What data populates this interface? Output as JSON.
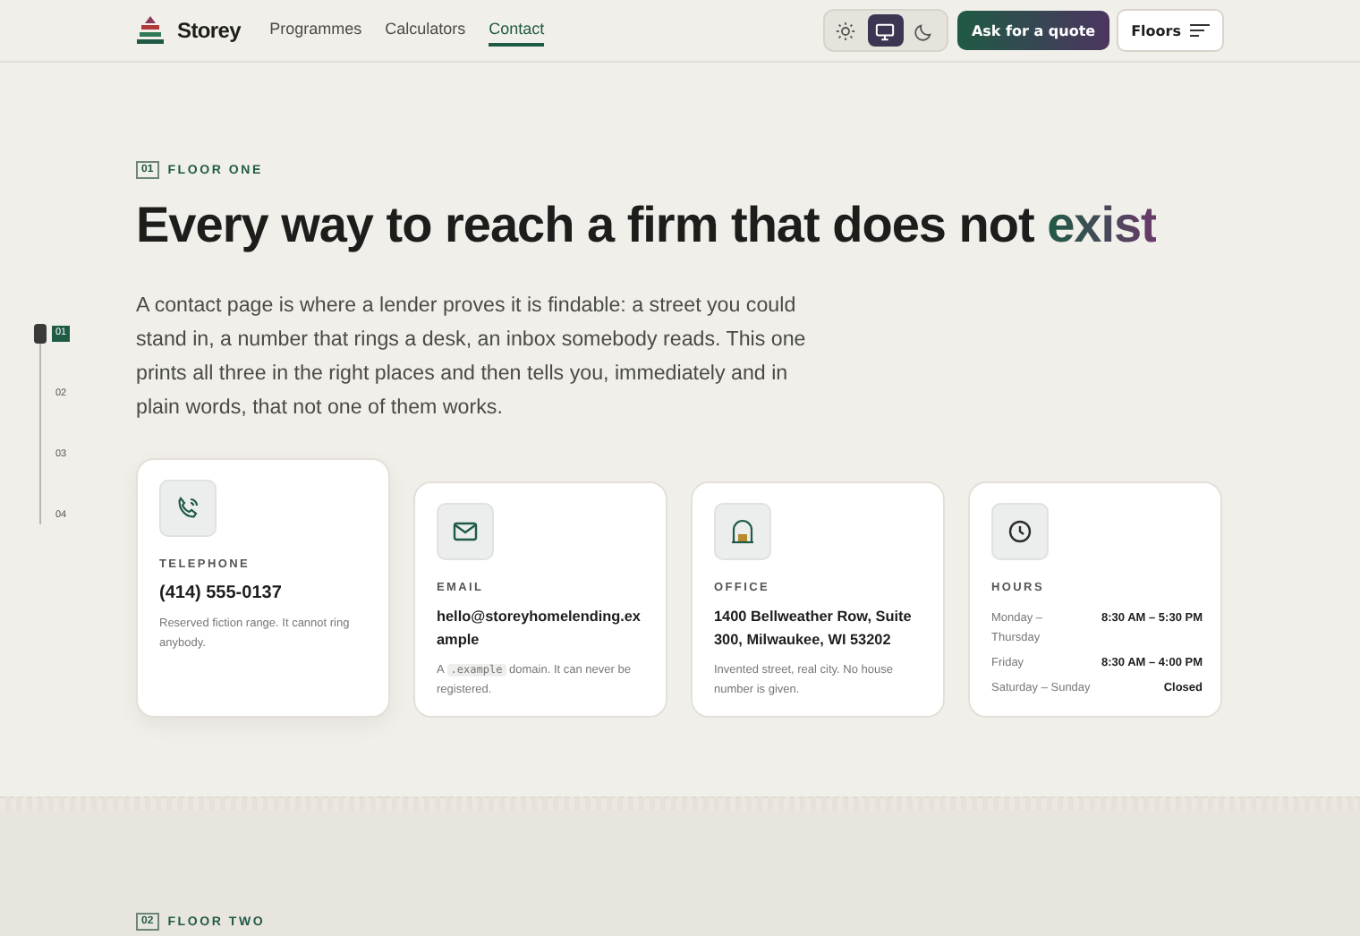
{
  "header": {
    "brand": "Storey",
    "nav": [
      {
        "label": "Programmes",
        "selected": false
      },
      {
        "label": "Calculators",
        "selected": false
      },
      {
        "label": "Contact",
        "selected": true
      }
    ],
    "themes": [
      {
        "kind": "light",
        "selected": false
      },
      {
        "kind": "system",
        "selected": true
      },
      {
        "kind": "dark",
        "selected": false
      }
    ],
    "quote_button": "Ask for a quote",
    "floors_button": "Floors"
  },
  "rail": [
    {
      "label": "01",
      "selected": true
    },
    {
      "label": "02",
      "selected": false
    },
    {
      "label": "03",
      "selected": false
    },
    {
      "label": "04",
      "selected": false
    }
  ],
  "section": {
    "number": "01",
    "eyebrow": "FLOOR ONE",
    "title": "Every way to reach a firm that does not",
    "title_accent": "exist",
    "intro": "A contact page is where a lender proves it is findable: a street you could stand in, a number that rings a desk, an inbox somebody reads. This one prints all three in the right places and then tells you, immediately and in plain words, that not one of them works.",
    "cards": [
      {
        "kind": "phone",
        "raised": true,
        "label": "TELEPHONE",
        "value": "(414) 555-0137",
        "note": [
          {
            "kind": "text",
            "text": "Reserved fiction range. It cannot ring anybody."
          }
        ]
      },
      {
        "kind": "email",
        "raised": false,
        "label": "EMAIL",
        "value": "hello@storeyhomelending.example",
        "note": [
          {
            "kind": "text",
            "text": "A"
          },
          {
            "kind": "code",
            "text": ".example"
          },
          {
            "kind": "text",
            "text": "domain. It can never be registered."
          }
        ]
      },
      {
        "kind": "office",
        "raised": false,
        "label": "OFFICE",
        "value": "1400 Bellweather Row, Suite 300, Milwaukee, WI 53202",
        "note": [
          {
            "kind": "text",
            "text": "Invented street, real city. No house number is given."
          }
        ]
      },
      {
        "kind": "hours",
        "raised": false,
        "label": "HOURS",
        "hours": [
          {
            "day": "Monday – Thursday",
            "time": "8:30 AM – 5:30 PM"
          },
          {
            "day": "Friday",
            "time": "8:30 AM – 4:00 PM"
          },
          {
            "day": "Saturday – Sunday",
            "time": "Closed"
          }
        ]
      }
    ]
  },
  "next_section": {
    "number": "02",
    "eyebrow": "FLOOR TWO"
  }
}
